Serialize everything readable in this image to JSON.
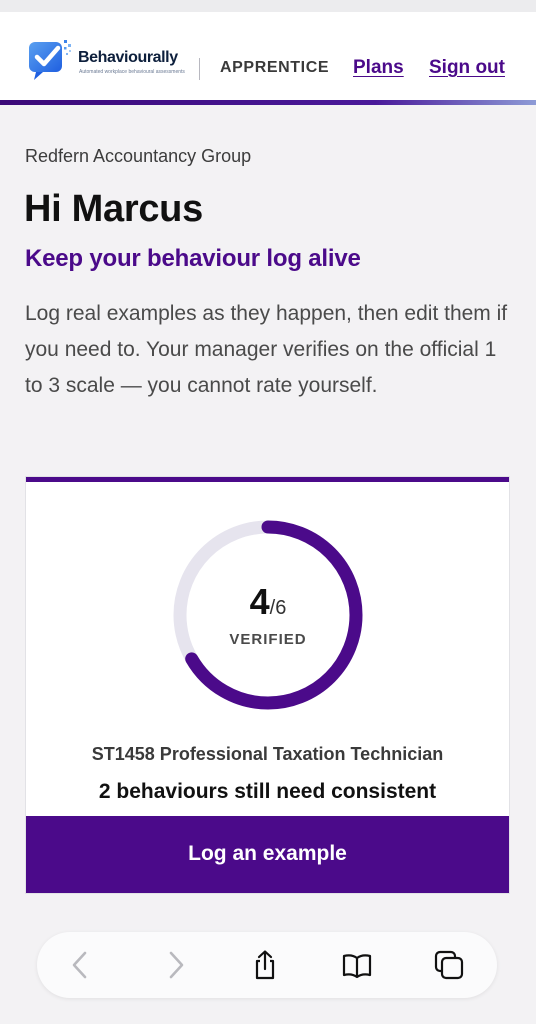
{
  "header": {
    "brand_name": "Behaviourally",
    "brand_tagline": "Automated workplace behavioural assessments",
    "role": "APPRENTICE",
    "nav": {
      "plans": "Plans",
      "sign_out": "Sign out"
    }
  },
  "main": {
    "organisation": "Redfern Accountancy Group",
    "greeting": "Hi Marcus",
    "subheading": "Keep your behaviour log alive",
    "intro": "Log real examples as they happen, then edit them if you need to. Your manager verifies on the official 1 to 3 scale — you cannot rate yourself."
  },
  "progress_card": {
    "verified": "4",
    "total": "/6",
    "verified_fraction": 0.6667,
    "label": "VERIFIED",
    "standard": "ST1458 Professional Taxation Technician",
    "pending_message": "2 behaviours still need consistent",
    "cta_label": "Log an example"
  },
  "colors": {
    "brand_purple": "#4b0a8a",
    "ring_track": "#e6e4ee",
    "page_bg": "#f3f2f4"
  },
  "browser_toolbar": {
    "icons": [
      "back-icon",
      "forward-icon",
      "share-icon",
      "bookmarks-icon",
      "tabs-icon"
    ]
  }
}
